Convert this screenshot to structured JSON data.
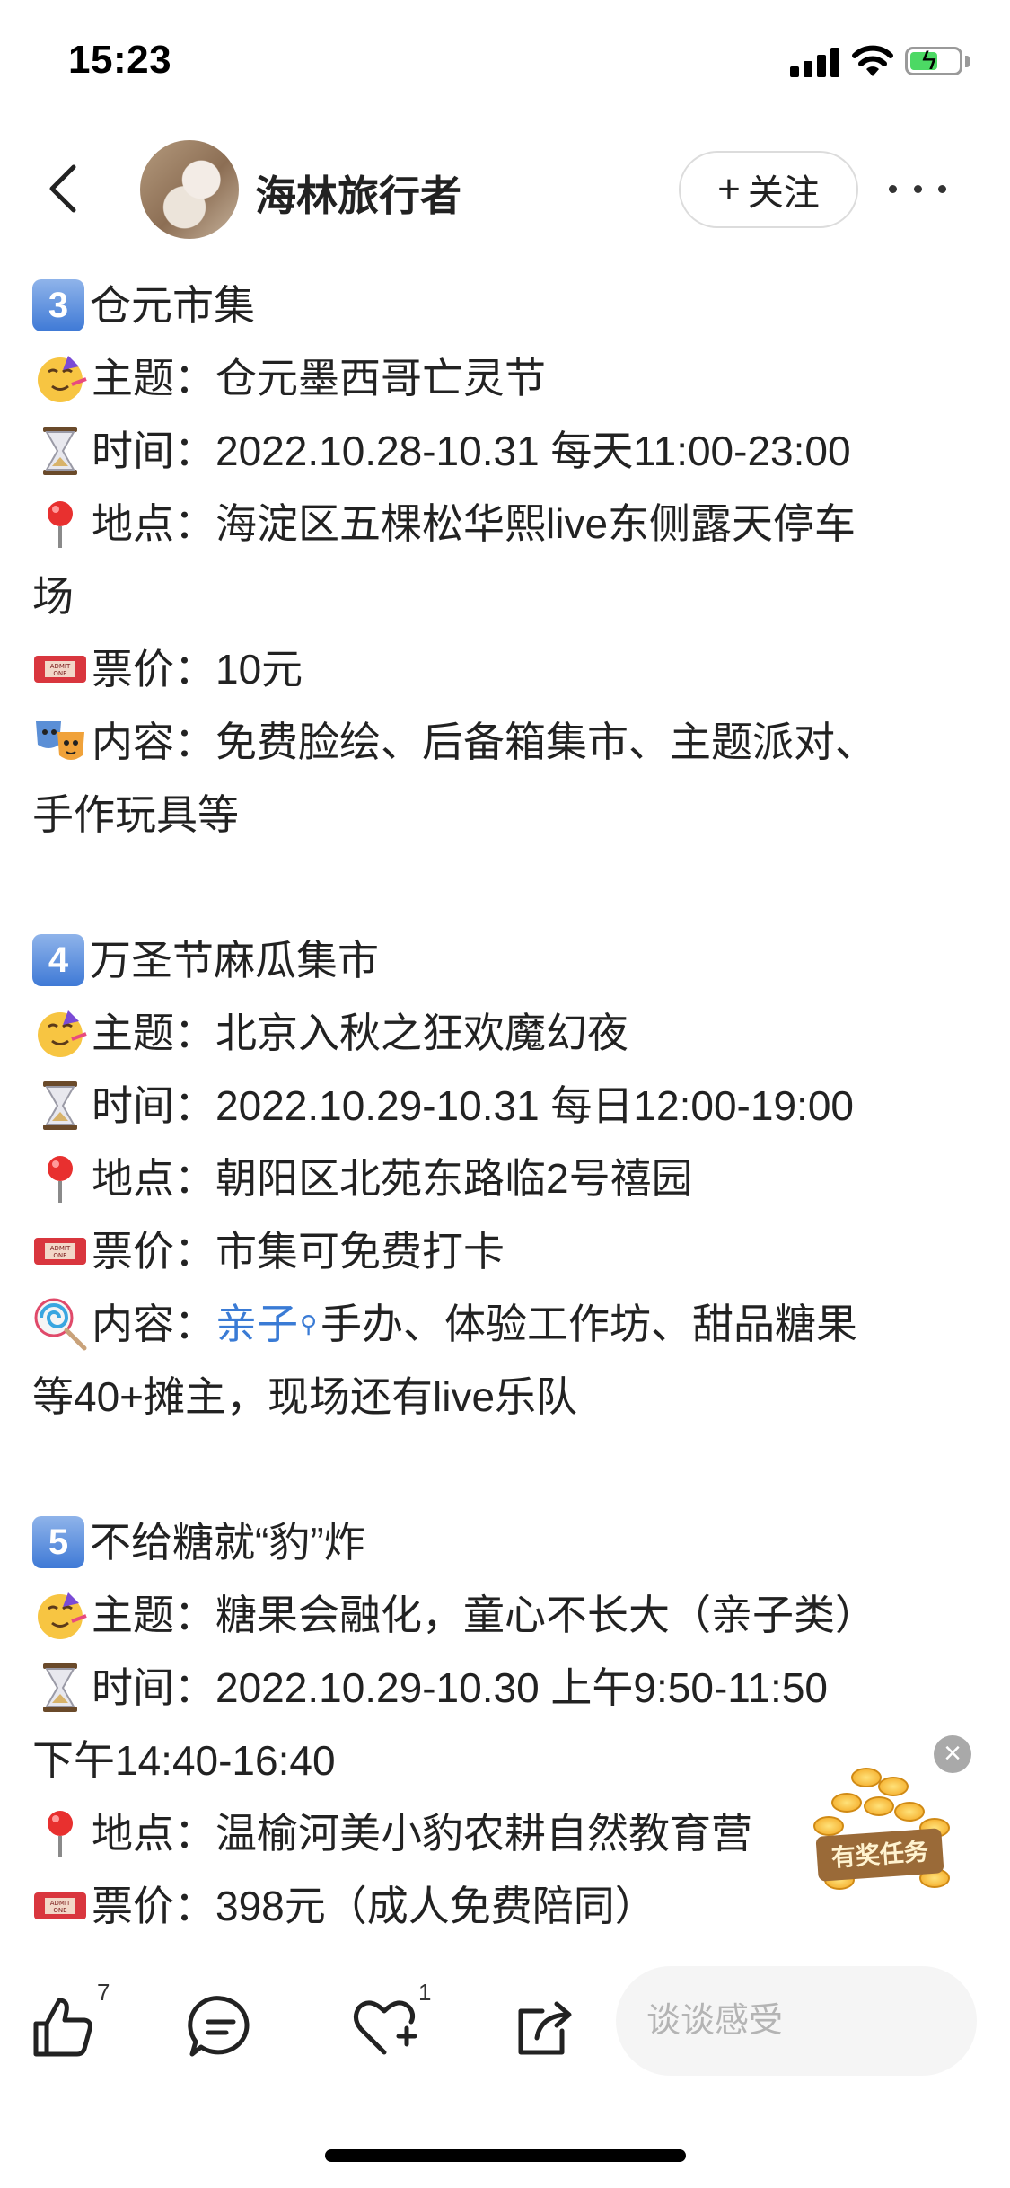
{
  "status_bar": {
    "time": "15:23"
  },
  "header": {
    "author": "海林旅行者",
    "follow_label": "关注",
    "follow_plus": "+"
  },
  "content": {
    "sections": [
      {
        "badge": "3",
        "title": "仓元市集",
        "theme_label": "主题：",
        "theme": "仓元墨西哥亡灵节",
        "time_label": "时间：",
        "time": "2022.10.28-10.31 每天11:00-23:00",
        "place_label": "地点：",
        "place_line1": "海淀区五棵松华熙live东侧露天停车",
        "place_line2": "场",
        "price_label": "票价：",
        "price": "10元",
        "content_label": "内容：",
        "content_line1": "免费脸绘、后备箱集市、主题派对、",
        "content_line2": "手作玩具等"
      },
      {
        "badge": "4",
        "title": "万圣节麻瓜集市",
        "theme_label": "主题：",
        "theme": "北京入秋之狂欢魔幻夜",
        "time_label": "时间：",
        "time": "2022.10.29-10.31 每日12:00-19:00",
        "place_label": "地点：",
        "place": "朝阳区北苑东路临2号禧园",
        "price_label": "票价：",
        "price": "市集可免费打卡",
        "content_label": "内容：",
        "content_tag": "亲子",
        "content_line1": "手办、体验工作坊、甜品糖果",
        "content_line2": "等40+摊主，现场还有live乐队"
      },
      {
        "badge": "5",
        "title": "不给糖就“豹”炸",
        "theme_label": "主题：",
        "theme": "糖果会融化，童心不长大（亲子类）",
        "time_label": "时间：",
        "time_line1": "2022.10.29-10.30 上午9:50-11:50",
        "time_line2": "下午14:40-16:40",
        "place_label": "地点：",
        "place": "温榆河美小豹农耕自然教育营",
        "price_label": "票价：",
        "price": "398元（成人免费陪同）"
      }
    ]
  },
  "floating": {
    "reward_label": "有奖任务",
    "close_glyph": "×"
  },
  "bottom_bar": {
    "like_count": "7",
    "favorite_count": "1",
    "comment_placeholder": "谈谈感受"
  },
  "colors": {
    "accent_blue": "#3a7bd5",
    "text": "#222222",
    "badge_blue": "#4a86dc"
  },
  "icons": [
    "back-icon",
    "more-icon",
    "party-face-icon",
    "hourglass-icon",
    "pin-icon",
    "ticket-icon",
    "masks-icon",
    "lollipop-icon",
    "search-icon",
    "thumbs-up-icon",
    "comment-icon",
    "heart-plus-icon",
    "share-icon",
    "close-icon"
  ]
}
